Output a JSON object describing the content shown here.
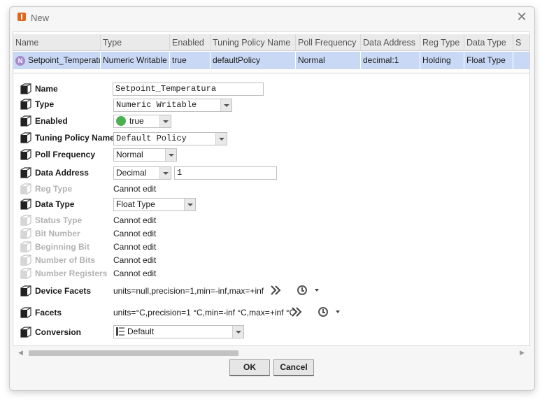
{
  "window": {
    "title": "New",
    "close_glyph": "✕"
  },
  "grid": {
    "columns": [
      "Name",
      "Type",
      "Enabled",
      "Tuning Policy Name",
      "Poll Frequency",
      "Data Address",
      "Reg Type",
      "Data Type",
      "S"
    ],
    "row": {
      "badge": "N",
      "cells": [
        "Setpoint_Temperatu",
        "Numeric Writable",
        "true",
        "defaultPolicy",
        "Normal",
        "decimal:1",
        "Holding",
        "Float Type",
        ""
      ]
    }
  },
  "properties": {
    "name": {
      "label": "Name",
      "value": "Setpoint_Temperatura"
    },
    "type": {
      "label": "Type",
      "value": "Numeric Writable"
    },
    "enabled": {
      "label": "Enabled",
      "value": "true"
    },
    "tuning_policy": {
      "label": "Tuning Policy Name",
      "value": "Default Policy"
    },
    "poll_frequency": {
      "label": "Poll Frequency",
      "value": "Normal"
    },
    "data_address": {
      "label": "Data Address",
      "format": "Decimal",
      "value": "1"
    },
    "reg_type": {
      "label": "Reg Type",
      "value": "Cannot edit"
    },
    "data_type": {
      "label": "Data Type",
      "value": "Float Type"
    },
    "status_type": {
      "label": "Status Type",
      "value": "Cannot edit"
    },
    "bit_number": {
      "label": "Bit Number",
      "value": "Cannot edit"
    },
    "beginning_bit": {
      "label": "Beginning Bit",
      "value": "Cannot edit"
    },
    "number_of_bits": {
      "label": "Number of Bits",
      "value": "Cannot edit"
    },
    "number_registers": {
      "label": "Number Registers",
      "value": "Cannot edit"
    },
    "device_facets": {
      "label": "Device Facets",
      "value": "units=null,precision=1,min=-inf,max=+inf"
    },
    "facets": {
      "label": "Facets",
      "value": "units=°C,precision=1 °C,min=-inf °C,max=+inf °C"
    },
    "conversion": {
      "label": "Conversion",
      "value": "Default"
    }
  },
  "buttons": {
    "ok": "OK",
    "cancel": "Cancel"
  },
  "icons": {
    "app": "niagara-app-icon",
    "row_badge": "numeric-point-icon",
    "property": "property-slot-icon",
    "facets_edit": "double-chevron-icon",
    "history": "clock-icon"
  },
  "colors": {
    "accent_selection": "#c9d9f5",
    "enabled_dot": "#4caf50",
    "row_badge": "#a78ac9",
    "app_icon": "#e2661c"
  }
}
